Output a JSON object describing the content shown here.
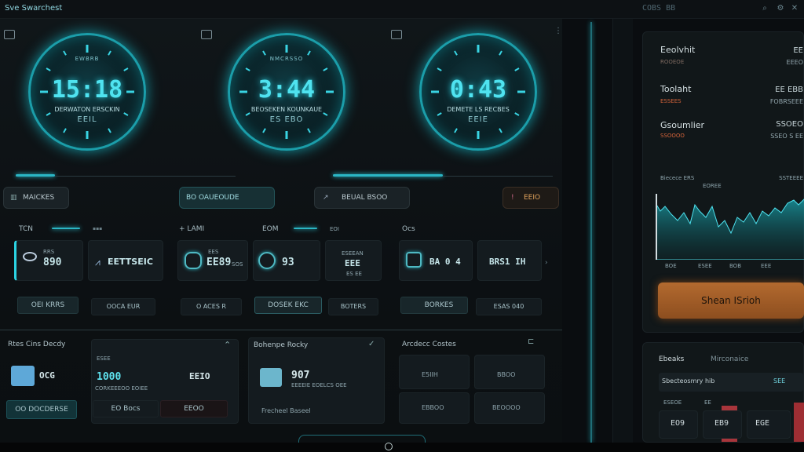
{
  "titlebar": {
    "app_title": "Sve Swarchest",
    "status": "COBS BB",
    "icons": [
      "search-icon",
      "gear-icon",
      "close-icon"
    ]
  },
  "clocks": [
    {
      "label": "EWBRB",
      "time": "15:18",
      "sub": "DERWATON ERSCKIN",
      "sub2": "EEIL"
    },
    {
      "label": "NMCRSSO",
      "time": "3:44",
      "sub": "BEOSEKEN KOUNKAUE",
      "sub2": "ES EBO"
    },
    {
      "label": "",
      "time": "0:43",
      "sub": "DEMETE LS RECBES",
      "sub2": "EEIE"
    }
  ],
  "controls": {
    "btn1": "MAICKES",
    "btn2": "BO OAUEOUDE",
    "btn3": "BEUAL BSOO",
    "btn4": "EEIO"
  },
  "grid": {
    "col1": {
      "title": "TCN",
      "tag": "RRS",
      "val": "890",
      "val2": "EETTSEIC",
      "pill1": "OEI KRRS",
      "pill2": "OOCA EUR"
    },
    "col2": {
      "title": "+ LAMI",
      "tag": "EES",
      "val": "EE89",
      "tag2": "SOS",
      "pill": "O ACES R"
    },
    "col3": {
      "title": "EOM",
      "tag": "EOI",
      "val": "93",
      "tag2": "ESEEAN",
      "val2": "EEE",
      "val3": "ES EE",
      "pill1": "DOSEK EKC",
      "pill2": "BOTERS"
    },
    "col4": {
      "title": "Ocs",
      "val": "BA 0 4",
      "val2": "BRS1 IH",
      "pill1": "BORKES",
      "pill2": "ESAS 040"
    }
  },
  "bottom": {
    "s1": {
      "title": "Rtes Cins Decdy",
      "tag": "ESEE",
      "val": "1000",
      "sub": "CORKEEEOO EOIEE",
      "val2": "EEIO",
      "badge": "OCG",
      "btn": "OO DOCDERSE",
      "pill1": "EO Bocs",
      "pill2": "EEOO"
    },
    "s2": {
      "title": "Bohenpe Rocky",
      "val": "907",
      "sub": "EEEEIE EOELCS OEE",
      "pill": "Frecheel Baseel"
    },
    "s3": {
      "title": "Arcdecc Costes",
      "v1": "E5IIH",
      "v2": "BBOO",
      "v3": "EBBOO",
      "v4": "BEOOOO"
    }
  },
  "right": {
    "items": [
      {
        "title": "Eeolvhit",
        "sub": "ROOEOE",
        "val": "EE",
        "val2": "EEEO"
      },
      {
        "title": "Toolaht",
        "sub": "ESSEES",
        "val": "EE EBB",
        "val2": "FOBRSEEE"
      },
      {
        "title": "Gsoumlier",
        "sub": "SSOOOO",
        "val": "SSOEO",
        "val2": "SSEO S EE"
      }
    ],
    "chart_label": "Biecece ERS",
    "chart_sub": "EOREE",
    "chart_right": "SSTEEEE",
    "chart_ticks": [
      "BOE",
      "ESEE",
      "BOB",
      "EEE"
    ],
    "share_label": "Shean ISrioh",
    "bottom_tab1": "Ebeaks",
    "bottom_tab2": "Mirconaice",
    "bottom_row": "Sbecteosmry hib",
    "bottom_row_val": "SEE",
    "bar_tags": [
      "ESEOE",
      "EE",
      "EE"
    ],
    "bar_vals": [
      "EO9",
      "EB9",
      "EGE"
    ]
  },
  "colors": {
    "accent": "#2bd3e3",
    "orange": "#b36a2f"
  }
}
